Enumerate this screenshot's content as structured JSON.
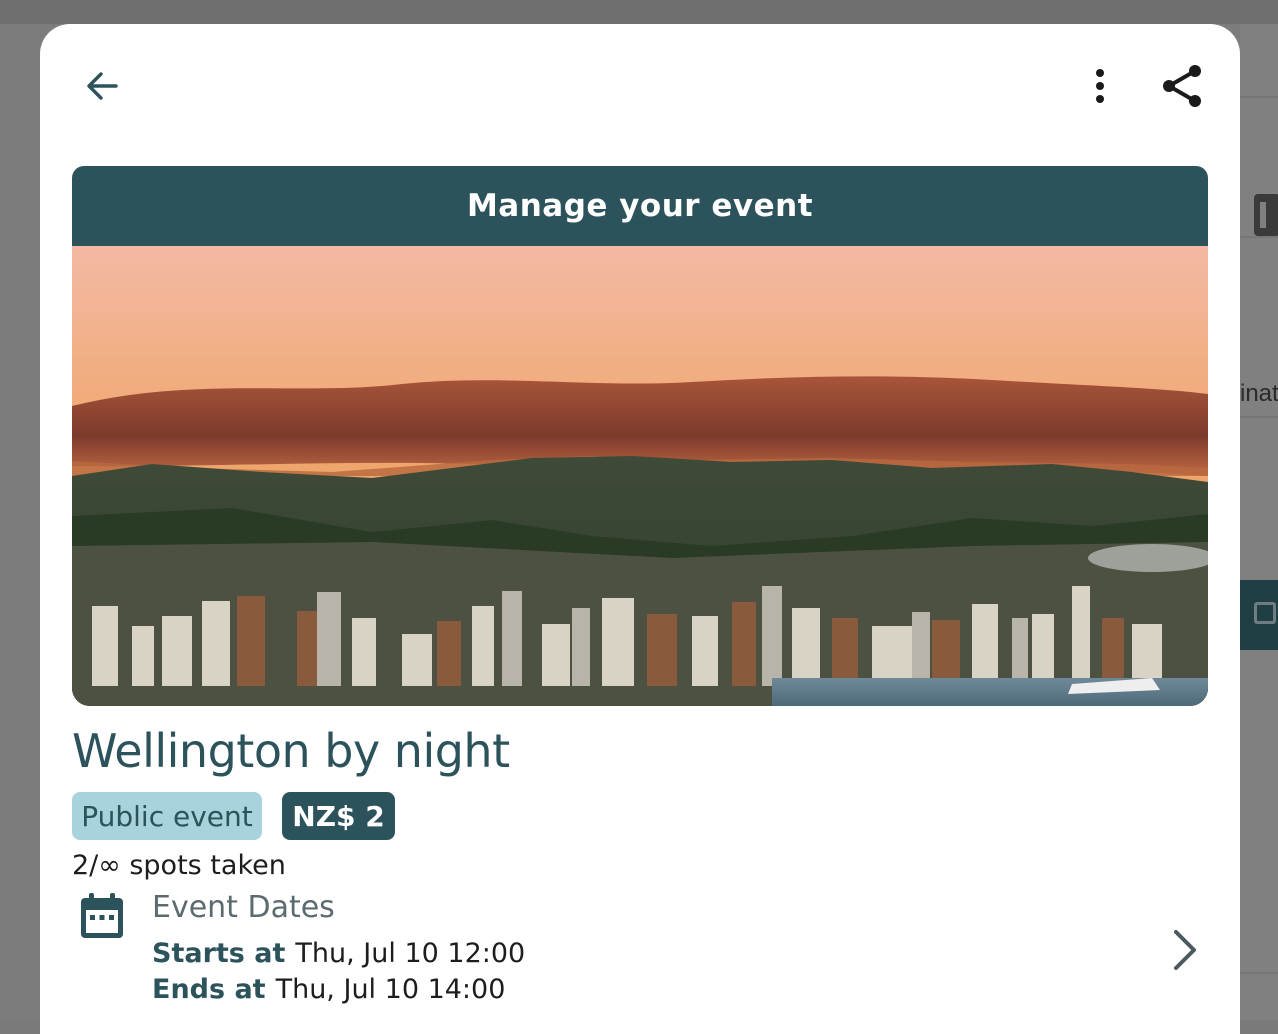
{
  "header": {
    "back_icon": "arrow-left-icon",
    "more_icon": "more-vert-icon",
    "share_icon": "share-icon"
  },
  "manage_banner": {
    "label": "Manage your event"
  },
  "event": {
    "title": "Wellington by night",
    "visibility_chip": "Public event",
    "price_chip": "NZ$ 2",
    "spots_text": "2/∞ spots taken",
    "dates": {
      "heading": "Event Dates",
      "starts_label": "Starts at",
      "starts_value": "Thu, Jul 10 12:00",
      "ends_label": "Ends at",
      "ends_value": "Thu, Jul 10 14:00",
      "icon": "calendar-icon",
      "chevron_icon": "chevron-right-icon"
    }
  },
  "background_page": {
    "partial_text": "inat"
  },
  "colors": {
    "primary": "#2c535b",
    "chip_light": "#a9d3dc",
    "overlay": "#7c7c7c",
    "surface": "#ffffff"
  }
}
